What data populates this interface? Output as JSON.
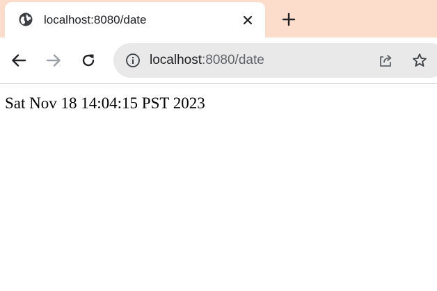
{
  "tab": {
    "title": "localhost:8080/date",
    "favicon_icon": "globe-icon",
    "close_icon": "close-icon"
  },
  "tabstrip": {
    "new_tab_icon": "plus-icon",
    "background_color": "#fcdccb"
  },
  "toolbar": {
    "back_icon": "arrow-left-icon",
    "forward_icon": "arrow-right-icon",
    "forward_enabled": false,
    "reload_icon": "reload-icon",
    "site_info_icon": "info-icon",
    "url_host": "localhost",
    "url_rest": ":8080/date",
    "share_icon": "share-icon",
    "bookmark_icon": "star-icon"
  },
  "page": {
    "text": "Sat Nov 18 14:04:15 PST 2023"
  }
}
